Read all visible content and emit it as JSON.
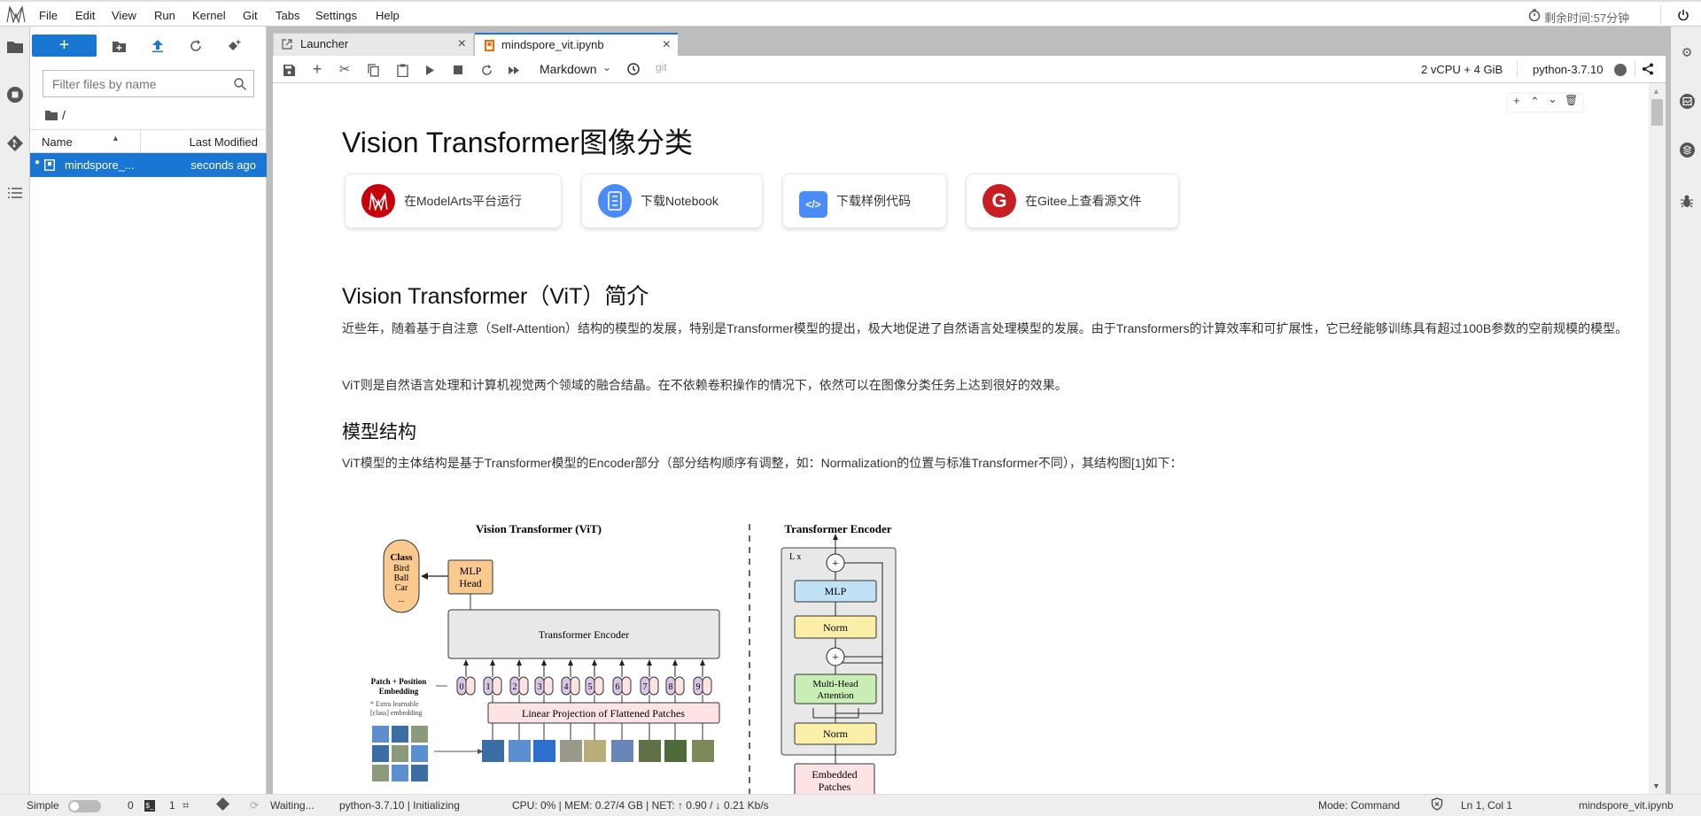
{
  "menubar": {
    "items": [
      "File",
      "Edit",
      "View",
      "Run",
      "Kernel",
      "Git",
      "Tabs",
      "Settings",
      "Help"
    ],
    "timer": "剩余时间:57分钟"
  },
  "filebrowser": {
    "new_label": "+",
    "filter_placeholder": "Filter files by name",
    "path": "/",
    "col_name": "Name",
    "col_modified": "Last Modified",
    "files": [
      {
        "name": "mindspore_...",
        "modified": "seconds ago"
      }
    ]
  },
  "tabs": [
    {
      "label": "Launcher"
    },
    {
      "label": "mindspore_vit.ipynb"
    }
  ],
  "toolbar": {
    "cell_type": "Markdown",
    "git": "git",
    "resources": "2 vCPU + 4 GiB",
    "kernel": "python-3.7.10"
  },
  "notebook": {
    "title": "Vision Transformer图像分类",
    "cards": [
      {
        "label": "在ModelArts平台运行"
      },
      {
        "label": "下载Notebook"
      },
      {
        "label": "下载样例代码"
      },
      {
        "label": "在Gitee上查看源文件"
      }
    ],
    "h2": "Vision Transformer（ViT）简介",
    "p1": "近些年，随着基于自注意（Self-Attention）结构的模型的发展，特别是Transformer模型的提出，极大地促进了自然语言处理模型的发展。由于Transformers的计算效率和可扩展性，它已经能够训练具有超过100B参数的空前规模的模型。",
    "p2": "ViT则是自然语言处理和计算机视觉两个领域的融合结晶。在不依赖卷积操作的情况下，依然可以在图像分类任务上达到很好的效果。",
    "h3": "模型结构",
    "p3": "ViT模型的主体结构是基于Transformer模型的Encoder部分（部分结构顺序有调整，如：Normalization的位置与标准Transformer不同），其结构图[1]如下：",
    "diagram": {
      "vit_title": "Vision Transformer (ViT)",
      "enc_title": "Transformer Encoder",
      "class": [
        "Class",
        "Bird",
        "Ball",
        "Car",
        "..."
      ],
      "mlp_head": [
        "MLP",
        "Head"
      ],
      "transformer_encoder": "Transformer Encoder",
      "patch_pos": [
        "Patch + Position",
        "Embedding"
      ],
      "extra": [
        "* Extra learnable",
        "[class] embedding"
      ],
      "linear_proj": "Linear Projection of Flattened Patches",
      "tokens": [
        "0",
        "1",
        "2",
        "3",
        "4",
        "5",
        "6",
        "7",
        "8",
        "9"
      ],
      "lx": "L x",
      "mlp": "MLP",
      "norm": "Norm",
      "mha": [
        "Multi-Head",
        "Attention"
      ],
      "embedded": [
        "Embedded",
        "Patches"
      ]
    }
  },
  "statusbar": {
    "mode_simple": "Simple",
    "terminals": "0",
    "kernels": "1",
    "waiting": "Waiting...",
    "kernel_status": "python-3.7.10 | Initializing",
    "resources": "CPU: 0% | MEM: 0.27/4 GB | NET: ↑ 0.90 / ↓ 0.21 Kb/s",
    "mode": "Mode: Command",
    "cursor": "Ln 1, Col 1",
    "filename": "mindspore_vit.ipynb"
  },
  "colors": {
    "accent": "#1976d2",
    "selected_row": "#1976d2"
  }
}
